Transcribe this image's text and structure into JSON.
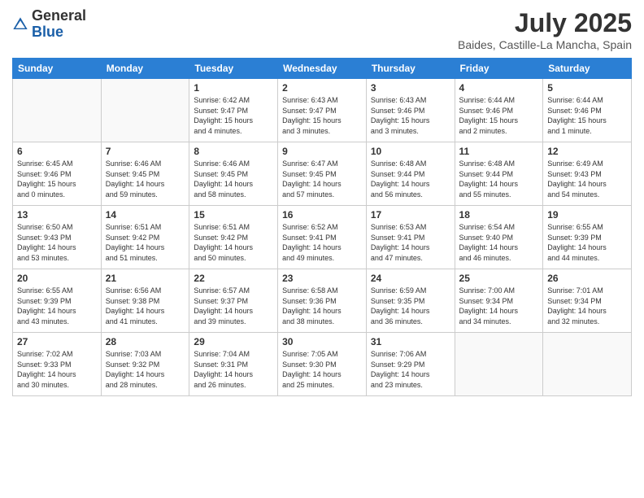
{
  "header": {
    "logo_general": "General",
    "logo_blue": "Blue",
    "month_title": "July 2025",
    "location": "Baides, Castille-La Mancha, Spain"
  },
  "weekdays": [
    "Sunday",
    "Monday",
    "Tuesday",
    "Wednesday",
    "Thursday",
    "Friday",
    "Saturday"
  ],
  "weeks": [
    [
      {
        "day": "",
        "info": ""
      },
      {
        "day": "",
        "info": ""
      },
      {
        "day": "1",
        "info": "Sunrise: 6:42 AM\nSunset: 9:47 PM\nDaylight: 15 hours\nand 4 minutes."
      },
      {
        "day": "2",
        "info": "Sunrise: 6:43 AM\nSunset: 9:47 PM\nDaylight: 15 hours\nand 3 minutes."
      },
      {
        "day": "3",
        "info": "Sunrise: 6:43 AM\nSunset: 9:46 PM\nDaylight: 15 hours\nand 3 minutes."
      },
      {
        "day": "4",
        "info": "Sunrise: 6:44 AM\nSunset: 9:46 PM\nDaylight: 15 hours\nand 2 minutes."
      },
      {
        "day": "5",
        "info": "Sunrise: 6:44 AM\nSunset: 9:46 PM\nDaylight: 15 hours\nand 1 minute."
      }
    ],
    [
      {
        "day": "6",
        "info": "Sunrise: 6:45 AM\nSunset: 9:46 PM\nDaylight: 15 hours\nand 0 minutes."
      },
      {
        "day": "7",
        "info": "Sunrise: 6:46 AM\nSunset: 9:45 PM\nDaylight: 14 hours\nand 59 minutes."
      },
      {
        "day": "8",
        "info": "Sunrise: 6:46 AM\nSunset: 9:45 PM\nDaylight: 14 hours\nand 58 minutes."
      },
      {
        "day": "9",
        "info": "Sunrise: 6:47 AM\nSunset: 9:45 PM\nDaylight: 14 hours\nand 57 minutes."
      },
      {
        "day": "10",
        "info": "Sunrise: 6:48 AM\nSunset: 9:44 PM\nDaylight: 14 hours\nand 56 minutes."
      },
      {
        "day": "11",
        "info": "Sunrise: 6:48 AM\nSunset: 9:44 PM\nDaylight: 14 hours\nand 55 minutes."
      },
      {
        "day": "12",
        "info": "Sunrise: 6:49 AM\nSunset: 9:43 PM\nDaylight: 14 hours\nand 54 minutes."
      }
    ],
    [
      {
        "day": "13",
        "info": "Sunrise: 6:50 AM\nSunset: 9:43 PM\nDaylight: 14 hours\nand 53 minutes."
      },
      {
        "day": "14",
        "info": "Sunrise: 6:51 AM\nSunset: 9:42 PM\nDaylight: 14 hours\nand 51 minutes."
      },
      {
        "day": "15",
        "info": "Sunrise: 6:51 AM\nSunset: 9:42 PM\nDaylight: 14 hours\nand 50 minutes."
      },
      {
        "day": "16",
        "info": "Sunrise: 6:52 AM\nSunset: 9:41 PM\nDaylight: 14 hours\nand 49 minutes."
      },
      {
        "day": "17",
        "info": "Sunrise: 6:53 AM\nSunset: 9:41 PM\nDaylight: 14 hours\nand 47 minutes."
      },
      {
        "day": "18",
        "info": "Sunrise: 6:54 AM\nSunset: 9:40 PM\nDaylight: 14 hours\nand 46 minutes."
      },
      {
        "day": "19",
        "info": "Sunrise: 6:55 AM\nSunset: 9:39 PM\nDaylight: 14 hours\nand 44 minutes."
      }
    ],
    [
      {
        "day": "20",
        "info": "Sunrise: 6:55 AM\nSunset: 9:39 PM\nDaylight: 14 hours\nand 43 minutes."
      },
      {
        "day": "21",
        "info": "Sunrise: 6:56 AM\nSunset: 9:38 PM\nDaylight: 14 hours\nand 41 minutes."
      },
      {
        "day": "22",
        "info": "Sunrise: 6:57 AM\nSunset: 9:37 PM\nDaylight: 14 hours\nand 39 minutes."
      },
      {
        "day": "23",
        "info": "Sunrise: 6:58 AM\nSunset: 9:36 PM\nDaylight: 14 hours\nand 38 minutes."
      },
      {
        "day": "24",
        "info": "Sunrise: 6:59 AM\nSunset: 9:35 PM\nDaylight: 14 hours\nand 36 minutes."
      },
      {
        "day": "25",
        "info": "Sunrise: 7:00 AM\nSunset: 9:34 PM\nDaylight: 14 hours\nand 34 minutes."
      },
      {
        "day": "26",
        "info": "Sunrise: 7:01 AM\nSunset: 9:34 PM\nDaylight: 14 hours\nand 32 minutes."
      }
    ],
    [
      {
        "day": "27",
        "info": "Sunrise: 7:02 AM\nSunset: 9:33 PM\nDaylight: 14 hours\nand 30 minutes."
      },
      {
        "day": "28",
        "info": "Sunrise: 7:03 AM\nSunset: 9:32 PM\nDaylight: 14 hours\nand 28 minutes."
      },
      {
        "day": "29",
        "info": "Sunrise: 7:04 AM\nSunset: 9:31 PM\nDaylight: 14 hours\nand 26 minutes."
      },
      {
        "day": "30",
        "info": "Sunrise: 7:05 AM\nSunset: 9:30 PM\nDaylight: 14 hours\nand 25 minutes."
      },
      {
        "day": "31",
        "info": "Sunrise: 7:06 AM\nSunset: 9:29 PM\nDaylight: 14 hours\nand 23 minutes."
      },
      {
        "day": "",
        "info": ""
      },
      {
        "day": "",
        "info": ""
      }
    ]
  ]
}
